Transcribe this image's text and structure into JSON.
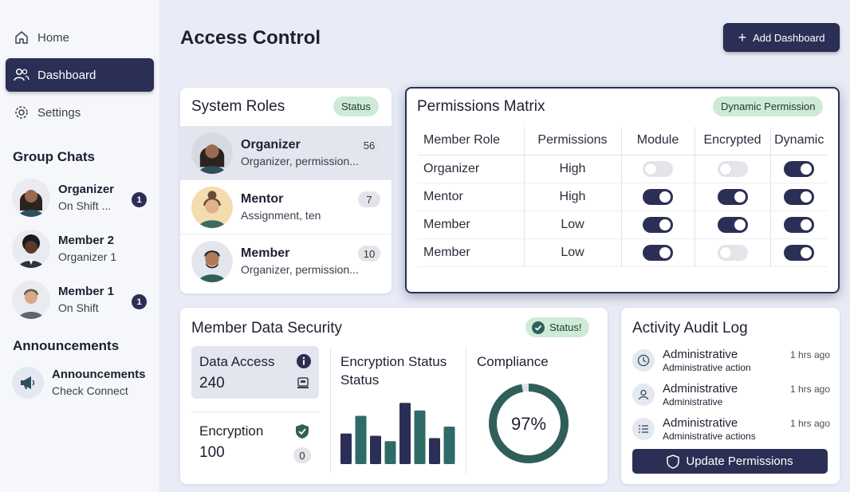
{
  "sidebar": {
    "nav": [
      {
        "label": "Home",
        "icon": "home-icon"
      },
      {
        "label": "Dashboard",
        "icon": "users-icon"
      },
      {
        "label": "Settings",
        "icon": "gear-icon"
      }
    ],
    "group_chats_heading": "Group Chats",
    "chats": [
      {
        "name": "Organizer",
        "status": "On Shift ...",
        "badge": "1"
      },
      {
        "name": "Member 2",
        "status": "Organizer 1",
        "badge": ""
      },
      {
        "name": "Member 1",
        "status": "On Shift",
        "badge": "1"
      }
    ],
    "announcements_heading": "Announcements",
    "announcement": {
      "title": "Announcements",
      "subtitle": "Check Connect"
    }
  },
  "header": {
    "title": "Access Control",
    "add_button": "Add Dashboard"
  },
  "system_roles": {
    "title": "System Roles",
    "status_pill": "Status",
    "roles": [
      {
        "name": "Organizer",
        "desc": "Organizer, permission...",
        "count": "56"
      },
      {
        "name": "Mentor",
        "desc": "Assignment, ten",
        "count": "7"
      },
      {
        "name": "Member",
        "desc": "Organizer, permission...",
        "count": "10"
      }
    ]
  },
  "permissions_matrix": {
    "title": "Permissions Matrix",
    "pill": "Dynamic Permission",
    "columns": [
      "Member Role",
      "Permissions",
      "Module",
      "Encrypted",
      "Dynamic"
    ],
    "rows": [
      {
        "role": "Organizer",
        "permission": "High",
        "module": false,
        "encrypted": false,
        "dynamic": true
      },
      {
        "role": "Mentor",
        "permission": "High",
        "module": true,
        "encrypted": true,
        "dynamic": true
      },
      {
        "role": "Member",
        "permission": "Low",
        "module": true,
        "encrypted": true,
        "dynamic": true
      },
      {
        "role": "Member",
        "permission": "Low",
        "module": true,
        "encrypted": false,
        "dynamic": true
      }
    ]
  },
  "data_security": {
    "title": "Member Data Security",
    "status_pill": "Status!",
    "data_access": {
      "label": "Data Access",
      "value": "240"
    },
    "encryption": {
      "label": "Encryption",
      "value": "100",
      "badge": "0"
    },
    "encryption_status_title": "Encryption Status Status",
    "bars": [
      {
        "value": 40,
        "color": "#2c2f55"
      },
      {
        "value": 63,
        "color": "#2f6b66"
      },
      {
        "value": 37,
        "color": "#2c2f55"
      },
      {
        "value": 30,
        "color": "#2f6b66"
      },
      {
        "value": 80,
        "color": "#2c2f55"
      },
      {
        "value": 70,
        "color": "#2f6b66"
      },
      {
        "value": 34,
        "color": "#2c2f55"
      },
      {
        "value": 49,
        "color": "#2f6b66"
      }
    ],
    "compliance_title": "Compliance",
    "compliance_value": "97%",
    "compliance_fraction": 0.97
  },
  "audit_log": {
    "title": "Activity Audit Log",
    "entries": [
      {
        "title": "Administrative",
        "sub": "Administrative action",
        "time": "1 hrs ago",
        "icon": "clock-icon"
      },
      {
        "title": "Administrative",
        "sub": "Administrative",
        "time": "1 hrs ago",
        "icon": "user-icon"
      },
      {
        "title": "Administrative",
        "sub": "Administrative actions",
        "time": "1 hrs ago",
        "icon": "list-icon"
      }
    ],
    "update_button": "Update Permissions"
  },
  "colors": {
    "navy": "#2c2f55",
    "teal": "#2f6b66",
    "green_pill": "#cfead6"
  }
}
